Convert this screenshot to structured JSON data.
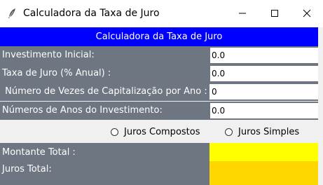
{
  "window": {
    "title": "Calculadora da Taxa de Juro",
    "icon": "feather-icon",
    "controls": [
      "minimize-icon",
      "maximize-icon",
      "close-icon"
    ]
  },
  "header": {
    "title": "Calculadora da Taxa de Juro"
  },
  "form": {
    "investimento": {
      "label": "Investimento Inicial:",
      "value": "0.0"
    },
    "taxa": {
      "label": "Taxa de Juro (% Anual) :",
      "value": "0.0"
    },
    "capitalizacao": {
      "label": " Número de Vezes de Capitalização por Ano :",
      "value": "0"
    },
    "anos": {
      "label": "Números de Anos do Investimento:",
      "value": "0.0"
    }
  },
  "options": {
    "compostos": {
      "label": "Juros Compostos",
      "selected": false
    },
    "simples": {
      "label": "Juros Simples",
      "selected": false
    }
  },
  "results": {
    "montante": {
      "label": "Montante Total :",
      "value": ""
    },
    "juros": {
      "label": "Juros Total:",
      "value": ""
    }
  },
  "colors": {
    "header_bg": "#0000ff",
    "label_bg": "#6e7681",
    "montante_bg": "#ffff00",
    "juros_bg": "#ffd700"
  }
}
